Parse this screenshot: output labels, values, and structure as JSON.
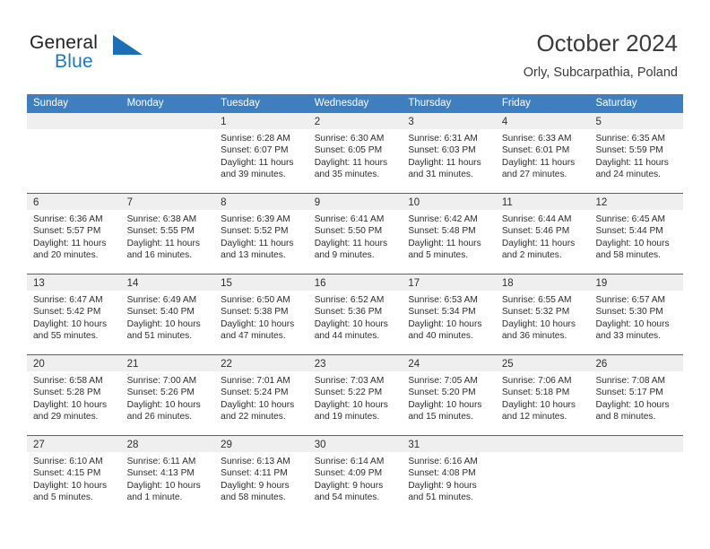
{
  "brand": {
    "word_general": "General",
    "word_blue": "Blue",
    "logo_icon": "triangle-flag-icon"
  },
  "header": {
    "title": "October 2024",
    "subtitle": "Orly, Subcarpathia, Poland"
  },
  "colors": {
    "header_blue": "#3f7fbf",
    "row_divider_blue": "#2b6cab",
    "day_band_gray": "#efefef",
    "brand_blue": "#1c79c0",
    "text": "#2d2d2d"
  },
  "weekdays": [
    "Sunday",
    "Monday",
    "Tuesday",
    "Wednesday",
    "Thursday",
    "Friday",
    "Saturday"
  ],
  "labels": {
    "sunrise_prefix": "Sunrise:",
    "sunset_prefix": "Sunset:",
    "daylight_prefix": "Daylight:"
  },
  "weeks": [
    [
      {
        "day": "",
        "sunrise": "",
        "sunset": "",
        "daylight_line1": "",
        "daylight_line2": ""
      },
      {
        "day": "",
        "sunrise": "",
        "sunset": "",
        "daylight_line1": "",
        "daylight_line2": ""
      },
      {
        "day": "1",
        "sunrise": "Sunrise: 6:28 AM",
        "sunset": "Sunset: 6:07 PM",
        "daylight_line1": "Daylight: 11 hours",
        "daylight_line2": "and 39 minutes."
      },
      {
        "day": "2",
        "sunrise": "Sunrise: 6:30 AM",
        "sunset": "Sunset: 6:05 PM",
        "daylight_line1": "Daylight: 11 hours",
        "daylight_line2": "and 35 minutes."
      },
      {
        "day": "3",
        "sunrise": "Sunrise: 6:31 AM",
        "sunset": "Sunset: 6:03 PM",
        "daylight_line1": "Daylight: 11 hours",
        "daylight_line2": "and 31 minutes."
      },
      {
        "day": "4",
        "sunrise": "Sunrise: 6:33 AM",
        "sunset": "Sunset: 6:01 PM",
        "daylight_line1": "Daylight: 11 hours",
        "daylight_line2": "and 27 minutes."
      },
      {
        "day": "5",
        "sunrise": "Sunrise: 6:35 AM",
        "sunset": "Sunset: 5:59 PM",
        "daylight_line1": "Daylight: 11 hours",
        "daylight_line2": "and 24 minutes."
      }
    ],
    [
      {
        "day": "6",
        "sunrise": "Sunrise: 6:36 AM",
        "sunset": "Sunset: 5:57 PM",
        "daylight_line1": "Daylight: 11 hours",
        "daylight_line2": "and 20 minutes."
      },
      {
        "day": "7",
        "sunrise": "Sunrise: 6:38 AM",
        "sunset": "Sunset: 5:55 PM",
        "daylight_line1": "Daylight: 11 hours",
        "daylight_line2": "and 16 minutes."
      },
      {
        "day": "8",
        "sunrise": "Sunrise: 6:39 AM",
        "sunset": "Sunset: 5:52 PM",
        "daylight_line1": "Daylight: 11 hours",
        "daylight_line2": "and 13 minutes."
      },
      {
        "day": "9",
        "sunrise": "Sunrise: 6:41 AM",
        "sunset": "Sunset: 5:50 PM",
        "daylight_line1": "Daylight: 11 hours",
        "daylight_line2": "and 9 minutes."
      },
      {
        "day": "10",
        "sunrise": "Sunrise: 6:42 AM",
        "sunset": "Sunset: 5:48 PM",
        "daylight_line1": "Daylight: 11 hours",
        "daylight_line2": "and 5 minutes."
      },
      {
        "day": "11",
        "sunrise": "Sunrise: 6:44 AM",
        "sunset": "Sunset: 5:46 PM",
        "daylight_line1": "Daylight: 11 hours",
        "daylight_line2": "and 2 minutes."
      },
      {
        "day": "12",
        "sunrise": "Sunrise: 6:45 AM",
        "sunset": "Sunset: 5:44 PM",
        "daylight_line1": "Daylight: 10 hours",
        "daylight_line2": "and 58 minutes."
      }
    ],
    [
      {
        "day": "13",
        "sunrise": "Sunrise: 6:47 AM",
        "sunset": "Sunset: 5:42 PM",
        "daylight_line1": "Daylight: 10 hours",
        "daylight_line2": "and 55 minutes."
      },
      {
        "day": "14",
        "sunrise": "Sunrise: 6:49 AM",
        "sunset": "Sunset: 5:40 PM",
        "daylight_line1": "Daylight: 10 hours",
        "daylight_line2": "and 51 minutes."
      },
      {
        "day": "15",
        "sunrise": "Sunrise: 6:50 AM",
        "sunset": "Sunset: 5:38 PM",
        "daylight_line1": "Daylight: 10 hours",
        "daylight_line2": "and 47 minutes."
      },
      {
        "day": "16",
        "sunrise": "Sunrise: 6:52 AM",
        "sunset": "Sunset: 5:36 PM",
        "daylight_line1": "Daylight: 10 hours",
        "daylight_line2": "and 44 minutes."
      },
      {
        "day": "17",
        "sunrise": "Sunrise: 6:53 AM",
        "sunset": "Sunset: 5:34 PM",
        "daylight_line1": "Daylight: 10 hours",
        "daylight_line2": "and 40 minutes."
      },
      {
        "day": "18",
        "sunrise": "Sunrise: 6:55 AM",
        "sunset": "Sunset: 5:32 PM",
        "daylight_line1": "Daylight: 10 hours",
        "daylight_line2": "and 36 minutes."
      },
      {
        "day": "19",
        "sunrise": "Sunrise: 6:57 AM",
        "sunset": "Sunset: 5:30 PM",
        "daylight_line1": "Daylight: 10 hours",
        "daylight_line2": "and 33 minutes."
      }
    ],
    [
      {
        "day": "20",
        "sunrise": "Sunrise: 6:58 AM",
        "sunset": "Sunset: 5:28 PM",
        "daylight_line1": "Daylight: 10 hours",
        "daylight_line2": "and 29 minutes."
      },
      {
        "day": "21",
        "sunrise": "Sunrise: 7:00 AM",
        "sunset": "Sunset: 5:26 PM",
        "daylight_line1": "Daylight: 10 hours",
        "daylight_line2": "and 26 minutes."
      },
      {
        "day": "22",
        "sunrise": "Sunrise: 7:01 AM",
        "sunset": "Sunset: 5:24 PM",
        "daylight_line1": "Daylight: 10 hours",
        "daylight_line2": "and 22 minutes."
      },
      {
        "day": "23",
        "sunrise": "Sunrise: 7:03 AM",
        "sunset": "Sunset: 5:22 PM",
        "daylight_line1": "Daylight: 10 hours",
        "daylight_line2": "and 19 minutes."
      },
      {
        "day": "24",
        "sunrise": "Sunrise: 7:05 AM",
        "sunset": "Sunset: 5:20 PM",
        "daylight_line1": "Daylight: 10 hours",
        "daylight_line2": "and 15 minutes."
      },
      {
        "day": "25",
        "sunrise": "Sunrise: 7:06 AM",
        "sunset": "Sunset: 5:18 PM",
        "daylight_line1": "Daylight: 10 hours",
        "daylight_line2": "and 12 minutes."
      },
      {
        "day": "26",
        "sunrise": "Sunrise: 7:08 AM",
        "sunset": "Sunset: 5:17 PM",
        "daylight_line1": "Daylight: 10 hours",
        "daylight_line2": "and 8 minutes."
      }
    ],
    [
      {
        "day": "27",
        "sunrise": "Sunrise: 6:10 AM",
        "sunset": "Sunset: 4:15 PM",
        "daylight_line1": "Daylight: 10 hours",
        "daylight_line2": "and 5 minutes."
      },
      {
        "day": "28",
        "sunrise": "Sunrise: 6:11 AM",
        "sunset": "Sunset: 4:13 PM",
        "daylight_line1": "Daylight: 10 hours",
        "daylight_line2": "and 1 minute."
      },
      {
        "day": "29",
        "sunrise": "Sunrise: 6:13 AM",
        "sunset": "Sunset: 4:11 PM",
        "daylight_line1": "Daylight: 9 hours",
        "daylight_line2": "and 58 minutes."
      },
      {
        "day": "30",
        "sunrise": "Sunrise: 6:14 AM",
        "sunset": "Sunset: 4:09 PM",
        "daylight_line1": "Daylight: 9 hours",
        "daylight_line2": "and 54 minutes."
      },
      {
        "day": "31",
        "sunrise": "Sunrise: 6:16 AM",
        "sunset": "Sunset: 4:08 PM",
        "daylight_line1": "Daylight: 9 hours",
        "daylight_line2": "and 51 minutes."
      },
      {
        "day": "",
        "sunrise": "",
        "sunset": "",
        "daylight_line1": "",
        "daylight_line2": ""
      },
      {
        "day": "",
        "sunrise": "",
        "sunset": "",
        "daylight_line1": "",
        "daylight_line2": ""
      }
    ]
  ]
}
